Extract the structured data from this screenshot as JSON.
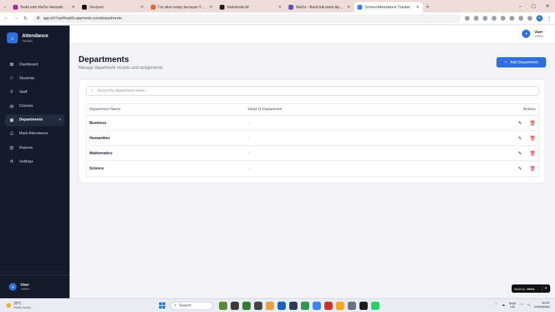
{
  "browser": {
    "tabs": [
      {
        "title": "Build with MeDo Hackathon - W",
        "color": "#b0279a"
      },
      {
        "title": "Devpost",
        "color": "#111111"
      },
      {
        "title": "I'm alive today because YOU!",
        "color": "#f0632a"
      },
      {
        "title": "NotebookLM",
        "color": "#222222"
      },
      {
        "title": "MeDo - Build full-stack Apps W",
        "color": "#5b4bdb"
      },
      {
        "title": "School Attendance Tracker",
        "color": "#3b82f6"
      }
    ],
    "url": "app-b07xg49xqb5t.appmedo.com/departments",
    "profile_initial": "K"
  },
  "sidebar": {
    "brand_title": "Attendance",
    "brand_subtitle": "Tracker",
    "items": [
      {
        "label": "Dashboard",
        "icon": "grid-icon",
        "glyph": "▦"
      },
      {
        "label": "Students",
        "icon": "users-icon",
        "glyph": "⚇"
      },
      {
        "label": "Staff",
        "icon": "user-check-icon",
        "glyph": "⚲"
      },
      {
        "label": "Classes",
        "icon": "book-icon",
        "glyph": "▤"
      },
      {
        "label": "Departments",
        "icon": "building-icon",
        "glyph": "▣"
      },
      {
        "label": "Mark Attendance",
        "icon": "clipboard-check-icon",
        "glyph": "☑"
      },
      {
        "label": "Reports",
        "icon": "bar-chart-icon",
        "glyph": "▥"
      },
      {
        "label": "Settings",
        "icon": "gear-icon",
        "glyph": "⚙"
      }
    ],
    "active_index": 4,
    "user": {
      "initial": "a",
      "name": "User",
      "role": "Admin"
    }
  },
  "header": {
    "user": {
      "initial": "a",
      "name": "User",
      "role": "Admin"
    }
  },
  "page": {
    "title": "Departments",
    "subtitle": "Manage department records and assignments",
    "add_button": "Add Department",
    "search_placeholder": "Search by department name...",
    "columns": [
      "Department Name",
      "Head of Department",
      "Actions"
    ],
    "rows": [
      {
        "name": "Business",
        "head": "-"
      },
      {
        "name": "Humanities",
        "head": "-"
      },
      {
        "name": "Mathematics",
        "head": "-"
      },
      {
        "name": "Science",
        "head": "-"
      }
    ]
  },
  "badge": {
    "text": "Made by",
    "brand": "MeDo"
  },
  "taskbar": {
    "weather_temp": "33°C",
    "weather_desc": "Partly sunny",
    "search_placeholder": "Search",
    "lang_top": "ENG",
    "lang_bottom": "US",
    "time": "15:24",
    "date": "27/04/2026",
    "app_colors": [
      "#5a8a3a",
      "#3a3a3a",
      "#2e7d32",
      "#444444",
      "#e6a23c",
      "#1565c0",
      "#2b3a55",
      "#2d9a4e",
      "#3b82f6",
      "#d32f2f",
      "#f5a623",
      "#6b7280",
      "#1a1a1a",
      "#25d366"
    ]
  }
}
